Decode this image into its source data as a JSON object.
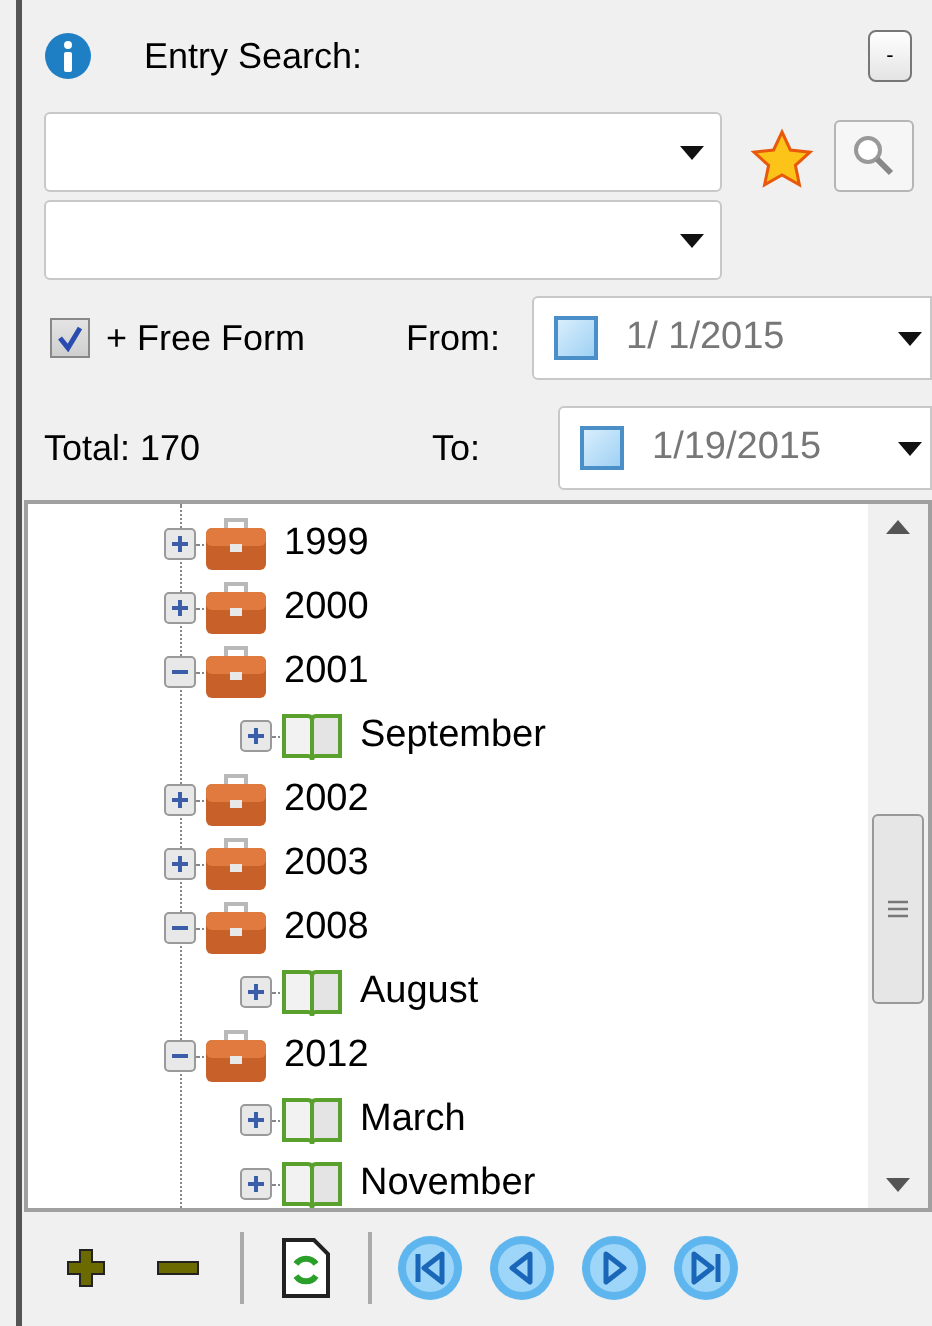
{
  "header": {
    "title": "Entry Search:",
    "collapse_button": "-"
  },
  "free_form": {
    "label": "+ Free Form",
    "checked": true
  },
  "total": "Total: 170",
  "from": {
    "label": "From:",
    "checked": false,
    "value": "1/ 1/2015"
  },
  "to": {
    "label": "To:",
    "checked": false,
    "value": "1/19/2015"
  },
  "tree": [
    {
      "kind": "year",
      "label": "1999",
      "expanded": false
    },
    {
      "kind": "year",
      "label": "2000",
      "expanded": false
    },
    {
      "kind": "year",
      "label": "2001",
      "expanded": true,
      "children": [
        {
          "kind": "month",
          "label": "September",
          "expanded": false
        }
      ]
    },
    {
      "kind": "year",
      "label": "2002",
      "expanded": false
    },
    {
      "kind": "year",
      "label": "2003",
      "expanded": false
    },
    {
      "kind": "year",
      "label": "2008",
      "expanded": true,
      "children": [
        {
          "kind": "month",
          "label": "August",
          "expanded": false
        }
      ]
    },
    {
      "kind": "year",
      "label": "2012",
      "expanded": true,
      "children": [
        {
          "kind": "month",
          "label": "March",
          "expanded": false
        },
        {
          "kind": "month",
          "label": "November",
          "expanded": false
        }
      ]
    }
  ]
}
